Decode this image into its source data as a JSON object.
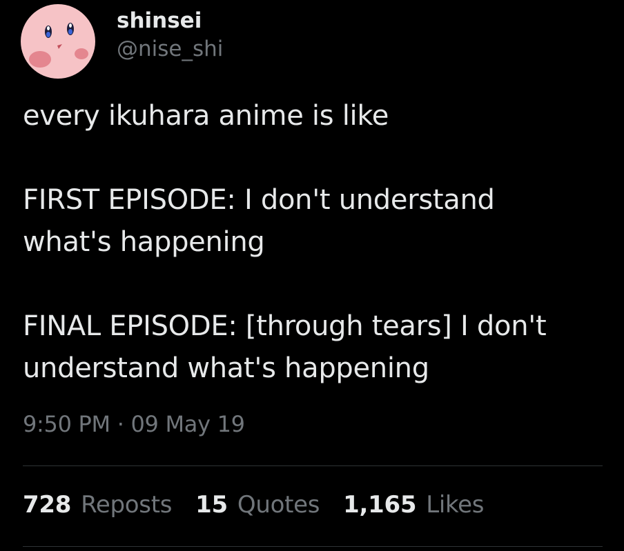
{
  "user": {
    "display_name": "shinsei",
    "handle": "@nise_shi",
    "avatar_icon": "pink-round-face-avatar"
  },
  "tweet": {
    "line1": "every ikuhara anime is like",
    "para2_line1": "FIRST EPISODE: I don't understand",
    "para2_line2": "what's happening",
    "para3_line1": "FINAL EPISODE: [through tears] I don't",
    "para3_line2": "understand what's happening",
    "timestamp": "9:50 PM · 09 May 19"
  },
  "stats": {
    "reposts_count": "728",
    "reposts_label": "Reposts",
    "quotes_count": "15",
    "quotes_label": "Quotes",
    "likes_count": "1,165",
    "likes_label": "Likes"
  },
  "colors": {
    "background": "#000000",
    "primary_text": "#e7e9ea",
    "secondary_text": "#71767b",
    "divider": "#2f3336",
    "avatar_pink": "#f6c3c6"
  }
}
